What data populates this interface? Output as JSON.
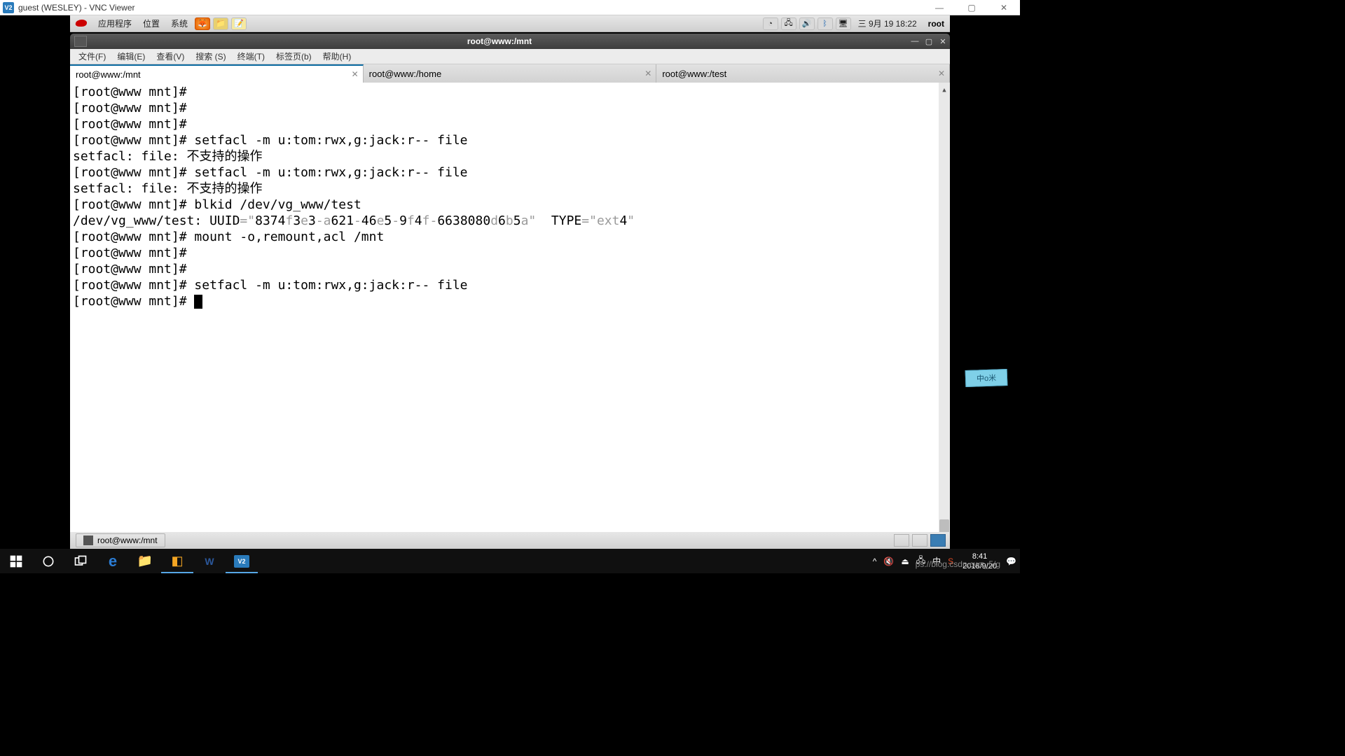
{
  "vnc_window": {
    "title": "guest (WESLEY) - VNC Viewer",
    "icon_text": "V2"
  },
  "gnome_top": {
    "menus": [
      "应用程序",
      "位置",
      "系统"
    ],
    "clock": "三 9月 19 18:22",
    "user": "root"
  },
  "terminal": {
    "window_title": "root@www:/mnt",
    "menubar": [
      "文件(F)",
      "编辑(E)",
      "查看(V)",
      "搜索 (S)",
      "终端(T)",
      "标签页(b)",
      "帮助(H)"
    ],
    "tabs": [
      {
        "label": "root@www:/mnt",
        "active": true
      },
      {
        "label": "root@www:/home",
        "active": false
      },
      {
        "label": "root@www:/test",
        "active": false
      }
    ],
    "lines": [
      {
        "prompt": "[root@www mnt]# ",
        "cmd": ""
      },
      {
        "prompt": "[root@www mnt]# ",
        "cmd": ""
      },
      {
        "prompt": "[root@www mnt]# ",
        "cmd": ""
      },
      {
        "prompt": "[root@www mnt]# ",
        "cmd": "setfacl -m u:tom:rwx,g:jack:r-- file"
      },
      {
        "out": "setfacl: file: 不支持的操作"
      },
      {
        "prompt": "[root@www mnt]# ",
        "cmd": "setfacl -m u:tom:rwx,g:jack:r-- file"
      },
      {
        "out": "setfacl: file: 不支持的操作"
      },
      {
        "prompt": "[root@www mnt]# ",
        "cmd": "blkid /dev/vg_www/test"
      },
      {
        "mixed": [
          {
            "t": "/dev/vg_www/test: UUID"
          },
          {
            "t": "=\"",
            "faint": true
          },
          {
            "t": "8374"
          },
          {
            "t": "f",
            "faint": true
          },
          {
            "t": "3"
          },
          {
            "t": "e",
            "faint": true
          },
          {
            "t": "3"
          },
          {
            "t": "-a",
            "faint": true
          },
          {
            "t": "621"
          },
          {
            "t": "-",
            "faint": true
          },
          {
            "t": "46"
          },
          {
            "t": "e",
            "faint": true
          },
          {
            "t": "5"
          },
          {
            "t": "-",
            "faint": true
          },
          {
            "t": "9"
          },
          {
            "t": "f",
            "faint": true
          },
          {
            "t": "4"
          },
          {
            "t": "f-",
            "faint": true
          },
          {
            "t": "6638080"
          },
          {
            "t": "d",
            "faint": true
          },
          {
            "t": "6"
          },
          {
            "t": "b",
            "faint": true
          },
          {
            "t": "5"
          },
          {
            "t": "a\" ",
            "faint": true
          },
          {
            "t": " TYPE"
          },
          {
            "t": "=\"ext",
            "faint": true
          },
          {
            "t": "4"
          },
          {
            "t": "\"",
            "faint": true
          }
        ]
      },
      {
        "prompt": "[root@www mnt]# ",
        "cmd": "mount -o,remount,acl /mnt"
      },
      {
        "prompt": "[root@www mnt]# ",
        "cmd": ""
      },
      {
        "prompt": "[root@www mnt]# ",
        "cmd": ""
      },
      {
        "prompt": "[root@www mnt]# ",
        "cmd": "setfacl -m u:tom:rwx,g:jack:r-- file"
      },
      {
        "prompt": "[root@www mnt]# ",
        "cmd": "",
        "cursor": true
      }
    ]
  },
  "gnome_bottom": {
    "task_label": "root@www:/mnt"
  },
  "win_taskbar": {
    "clock_time": "8:41",
    "clock_date": "2018/9/20",
    "ime": "中"
  },
  "sticker": "中o米",
  "watermark": "ps://blog.csdn.cwz_5/g"
}
